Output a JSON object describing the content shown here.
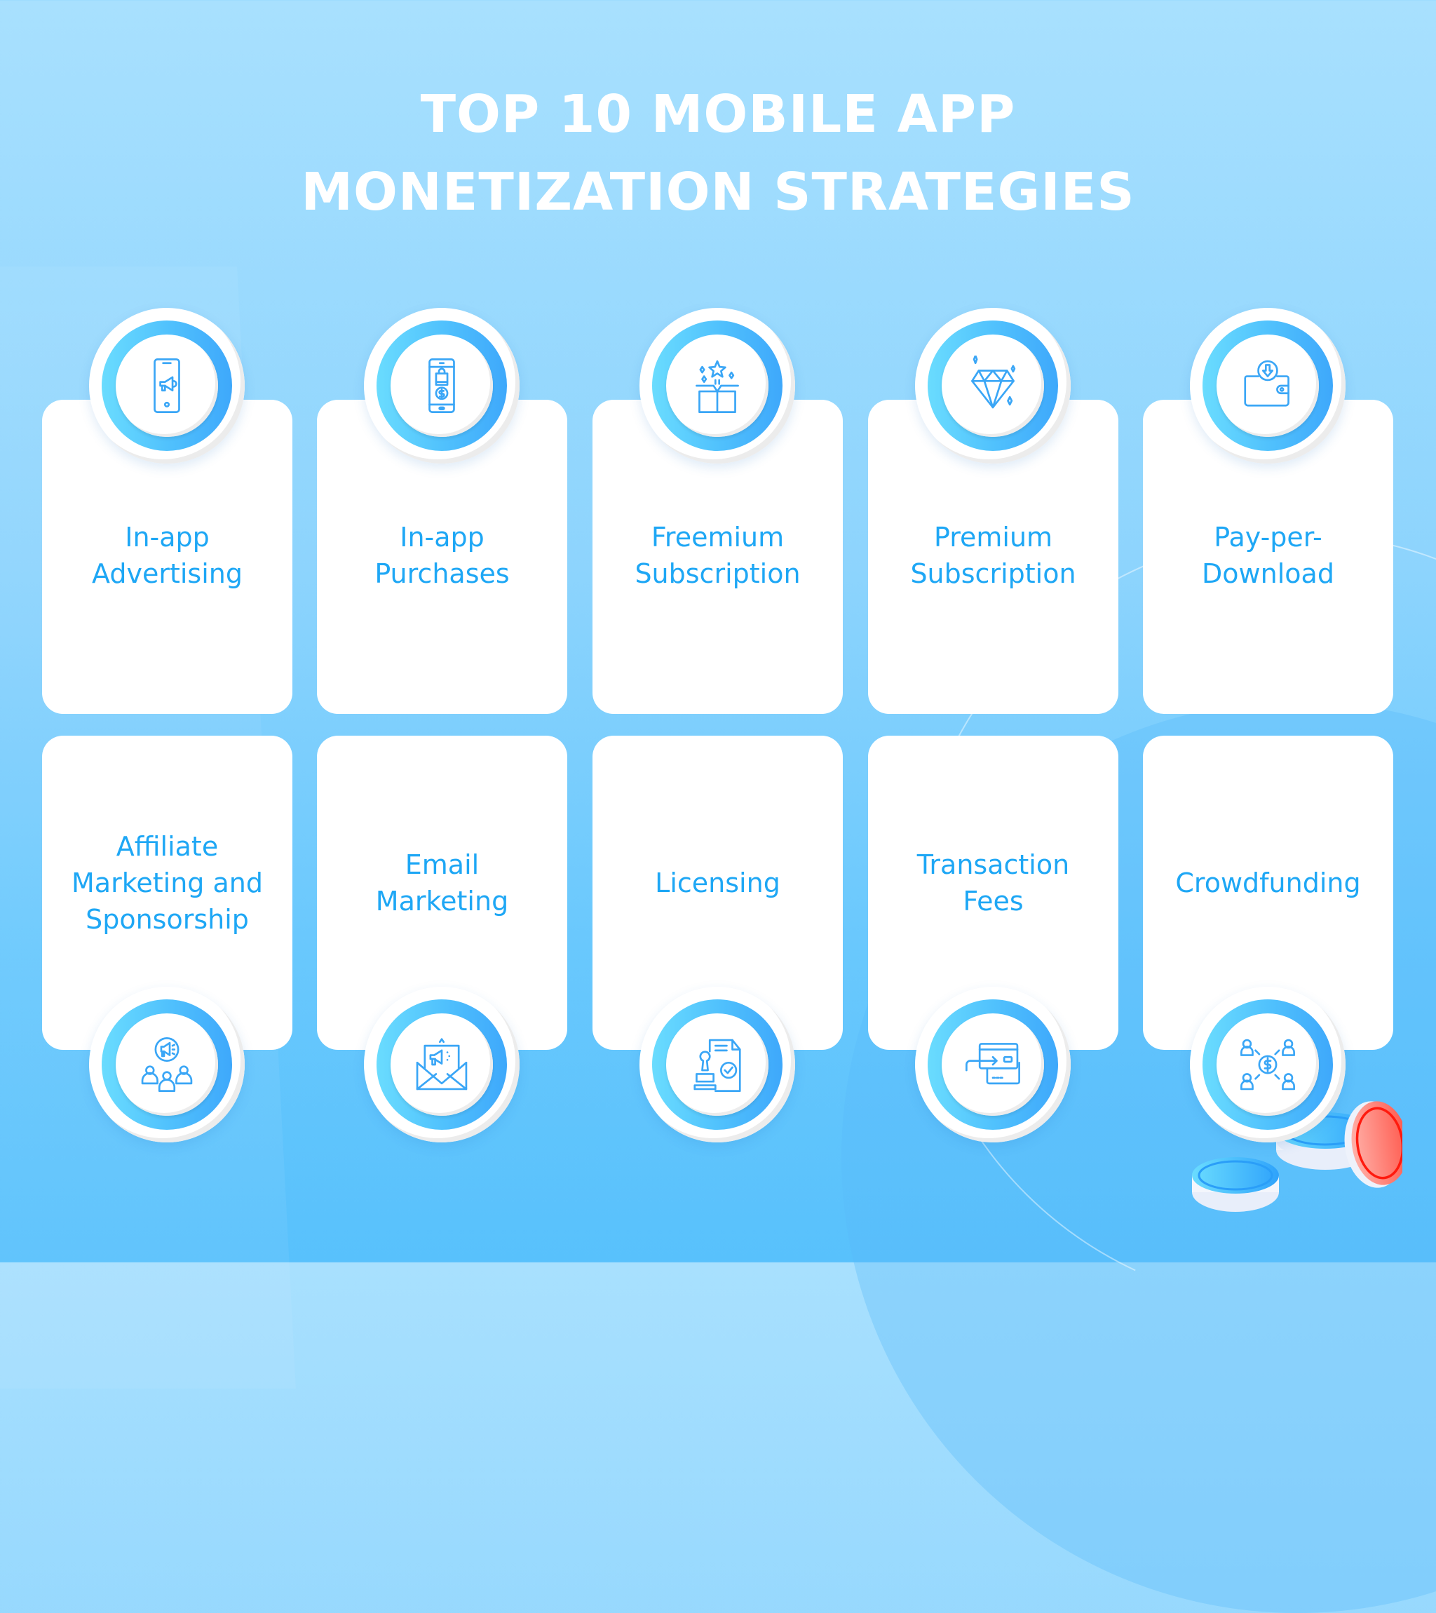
{
  "title": {
    "line1": "TOP 10 MOBILE APP",
    "line2": "MONETIZATION STRATEGIES"
  },
  "colors": {
    "background_top": "#a8e0fe",
    "background_bottom": "#58c1fc",
    "label_text": "#1ea7f5",
    "ring_gradient_start": "#6adcfe",
    "ring_gradient_end": "#3ea8fb",
    "icon_stroke": "#3aa6f6",
    "coin_red": "#ff3b30"
  },
  "strategies": [
    {
      "label": "In-app Advertising",
      "lines": [
        "In-app",
        "Advertising"
      ],
      "icon": "phone-megaphone-icon"
    },
    {
      "label": "In-app Purchases",
      "lines": [
        "In-app",
        "Purchases"
      ],
      "icon": "phone-shopping-dollar-icon"
    },
    {
      "label": "Freemium Subscription",
      "lines": [
        "Freemium",
        "Subscription"
      ],
      "icon": "gift-box-star-icon"
    },
    {
      "label": "Premium Subscription",
      "lines": [
        "Premium",
        "Subscription"
      ],
      "icon": "diamond-icon"
    },
    {
      "label": "Pay-per-Download",
      "lines": [
        "Pay-per-",
        "Download"
      ],
      "icon": "wallet-download-icon"
    },
    {
      "label": "Affiliate Marketing and Sponsorship",
      "lines": [
        "Affiliate",
        "Marketing and",
        "Sponsorship"
      ],
      "icon": "audience-megaphone-icon"
    },
    {
      "label": "Email Marketing",
      "lines": [
        "Email",
        "Marketing"
      ],
      "icon": "envelope-megaphone-icon"
    },
    {
      "label": "Licensing",
      "lines": [
        "Licensing"
      ],
      "icon": "stamp-document-icon"
    },
    {
      "label": "Transaction Fees",
      "lines": [
        "Transaction",
        "Fees"
      ],
      "icon": "card-transfer-icon"
    },
    {
      "label": "Crowdfunding",
      "lines": [
        "Crowdfunding"
      ],
      "icon": "people-dollar-icon"
    }
  ],
  "decoration": {
    "coins": "coin-stack-icon"
  }
}
